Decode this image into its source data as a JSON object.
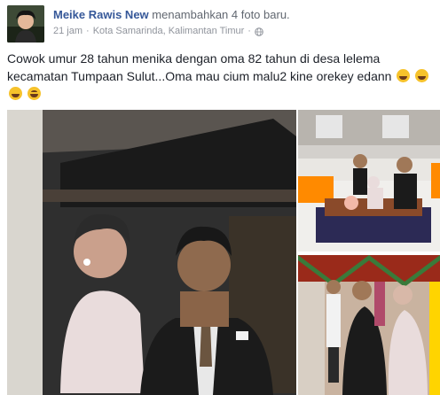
{
  "post": {
    "author": "Meike Rawis New",
    "action": "menambahkan 4 foto baru.",
    "time": "21 jam",
    "separator": "·",
    "location": "Kota Samarinda, Kalimantan Timur",
    "separator2": "·",
    "privacy_icon": "globe-icon",
    "text": "Cowok umur 28 tahun menika dengan oma 82 tahun di desa lelema kecamatan Tumpaan Sulut...Oma mau cium malu2 kine orekey edann",
    "emojis": [
      "grinning-sweat-emoji",
      "grinning-sweat-emoji",
      "grinning-sweat-emoji",
      "laughing-emoji"
    ]
  },
  "colors": {
    "author": "#365899",
    "meta": "#90949c",
    "text": "#1d2129",
    "emoji": "#f6c22b"
  }
}
